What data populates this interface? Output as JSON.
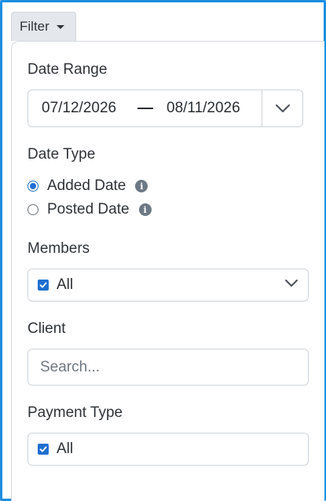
{
  "filter_button": {
    "label": "Filter",
    "icon": "caret-down-icon"
  },
  "date_range": {
    "label": "Date Range",
    "start": "07/12/2026",
    "end": "08/11/2026",
    "toggle_icon": "chevron-down-icon"
  },
  "date_type": {
    "label": "Date Type",
    "options": [
      {
        "label": "Added Date",
        "selected": true,
        "info_icon": "info-icon"
      },
      {
        "label": "Posted Date",
        "selected": false,
        "info_icon": "info-icon"
      }
    ]
  },
  "members": {
    "label": "Members",
    "selected_value": "All",
    "checked": true
  },
  "client": {
    "label": "Client",
    "placeholder": "Search..."
  },
  "payment_type": {
    "label": "Payment Type",
    "selected_value": "All",
    "checked": true
  },
  "colors": {
    "accent": "#1f6fd0",
    "frame_border": "#1a8fe0",
    "info_icon_bg": "#6c7884"
  }
}
